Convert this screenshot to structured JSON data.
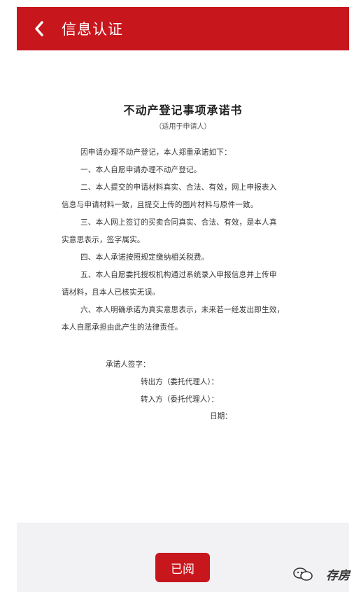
{
  "header": {
    "title": "信息认证"
  },
  "document": {
    "title": "不动产登记事项承诺书",
    "subtitle": "（适用于申请人）",
    "lines": [
      "因申请办理不动产登记，本人郑重承诺如下：",
      "一、本人自愿申请办理不动产登记。",
      "二、本人提交的申请材料真实、合法、有效，网上申报表入",
      "信息与申请材料一致，且提交上传的图片材料与原件一致。",
      "三、本人网上签订的买卖合同真实、合法、有效，是本人真",
      "实意思表示，签字属实。",
      "四、本人承诺按照规定缴纳相关税费。",
      "五、本人自愿委托授权机构通过系统录入申报信息并上传申",
      "请材料，且本人已核实无误。",
      "六、本人明确承诺为真实意思表示，未来若一经发出即生效，",
      "本人自愿承担由此产生的法律责任。"
    ],
    "signature": {
      "signer_label": "承诺人签字：",
      "transferor_label": "转出方（委托代理人）：",
      "transferee_label": "转入方（委托代理人）：",
      "date_label": "日期："
    }
  },
  "footer": {
    "confirm_label": "已阅"
  },
  "watermark": {
    "text": "存房"
  }
}
